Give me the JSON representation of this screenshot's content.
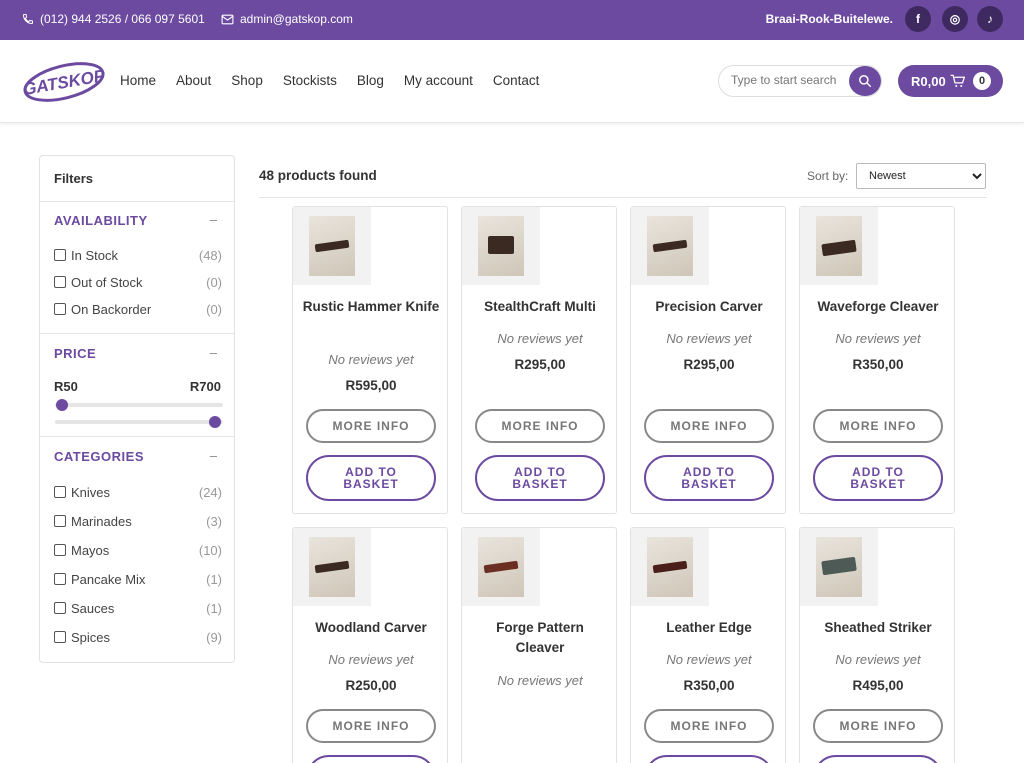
{
  "topbar": {
    "phone": "(012) 944 2526  /  066 097 5601",
    "email": "admin@gatskop.com",
    "slogan": "Braai-Rook-Buitelewe.",
    "social": [
      {
        "icon": "facebook-icon",
        "glyph": "f"
      },
      {
        "icon": "instagram-icon",
        "glyph": "◎"
      },
      {
        "icon": "tiktok-icon",
        "glyph": "♪"
      }
    ]
  },
  "brand": {
    "logo_text": "GATSKOP",
    "accent": "#6b4aa0"
  },
  "nav": [
    "Home",
    "About",
    "Shop",
    "Stockists",
    "Blog",
    "My account",
    "Contact"
  ],
  "search": {
    "placeholder": "Type to start search"
  },
  "cart": {
    "total": "R0,00",
    "count": "0"
  },
  "filters": {
    "title": "Filters",
    "availability": {
      "title": "AVAILABILITY",
      "toggle": "–",
      "items": [
        {
          "label": "In Stock",
          "count": "(48)"
        },
        {
          "label": "Out of Stock",
          "count": "(0)"
        },
        {
          "label": "On Backorder",
          "count": "(0)"
        }
      ]
    },
    "price": {
      "title": "PRICE",
      "toggle": "–",
      "min": "R50",
      "max": "R700"
    },
    "categories": {
      "title": "CATEGORIES",
      "toggle": "–",
      "items": [
        {
          "label": "Knives",
          "count": "(24)"
        },
        {
          "label": "Marinades",
          "count": "(3)"
        },
        {
          "label": "Mayos",
          "count": "(10)"
        },
        {
          "label": "Pancake Mix",
          "count": "(1)"
        },
        {
          "label": "Sauces",
          "count": "(1)"
        },
        {
          "label": "Spices",
          "count": "(9)"
        }
      ]
    }
  },
  "results": {
    "found": "48 products found",
    "sort_label": "Sort by:",
    "sort_value": "Newest"
  },
  "buttons": {
    "more_info": "MORE INFO",
    "add_to_basket": "ADD TO BASKET"
  },
  "products": [
    {
      "name": "Rustic Hammer Knife",
      "reviews": "No reviews yet",
      "price": "R595,00"
    },
    {
      "name": "StealthCraft Multi",
      "reviews": "No reviews yet",
      "price": "R295,00"
    },
    {
      "name": "Precision Carver",
      "reviews": "No reviews yet",
      "price": "R295,00"
    },
    {
      "name": "Waveforge Cleaver",
      "reviews": "No reviews yet",
      "price": "R350,00"
    },
    {
      "name": "Woodland Carver",
      "reviews": "No reviews yet",
      "price": "R250,00"
    },
    {
      "name": "Forge Pattern Cleaver",
      "reviews": "No reviews yet",
      "price": ""
    },
    {
      "name": "Leather Edge",
      "reviews": "No reviews yet",
      "price": "R350,00"
    },
    {
      "name": "Sheathed Striker",
      "reviews": "No reviews yet",
      "price": "R495,00"
    }
  ]
}
